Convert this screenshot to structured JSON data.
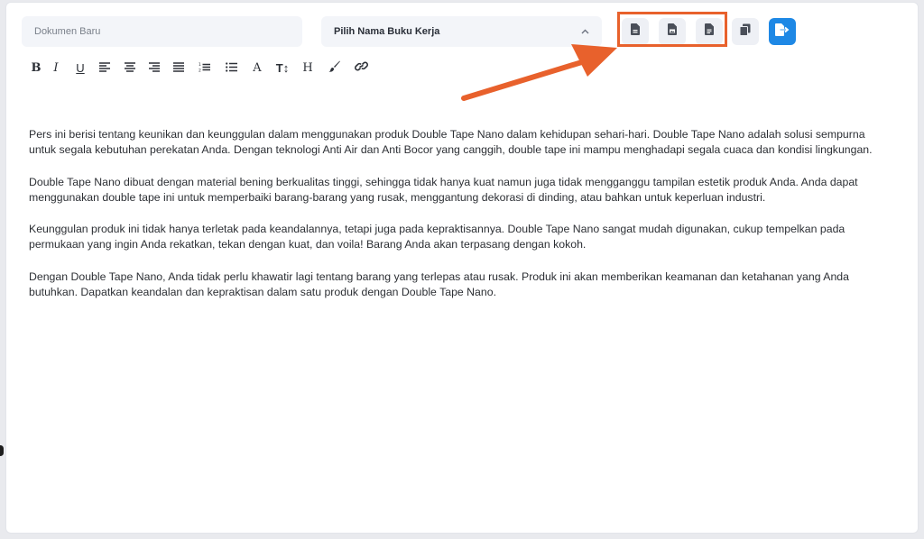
{
  "document": {
    "title_placeholder": "Dokumen Baru"
  },
  "workbook_select": {
    "label": "Pilih Nama Buku Kerja",
    "icon": "chevron-up-icon"
  },
  "export_buttons": [
    {
      "name": "export-doc-button-1",
      "icon": "file-icon"
    },
    {
      "name": "export-doc-button-2",
      "icon": "file-image-icon"
    },
    {
      "name": "export-doc-button-3",
      "icon": "file-text-icon"
    }
  ],
  "copy_button": {
    "icon": "copy-icon"
  },
  "save_button": {
    "icon": "file-export-icon",
    "color": "#1e88e5"
  },
  "annotation": {
    "color": "#e8612c"
  },
  "toolbar": {
    "bold": "B",
    "italic": "I",
    "underline": "U",
    "font_size": "A",
    "text_height": "T↕",
    "heading": "H"
  },
  "content": {
    "paragraphs": [
      "Pers ini berisi tentang keunikan dan keunggulan dalam menggunakan produk Double Tape Nano dalam kehidupan sehari-hari. Double Tape Nano adalah solusi sempurna untuk segala kebutuhan perekatan Anda. Dengan teknologi Anti Air dan Anti Bocor yang canggih, double tape ini mampu menghadapi segala cuaca dan kondisi lingkungan.",
      "Double Tape Nano dibuat dengan material bening berkualitas tinggi, sehingga tidak hanya kuat namun juga tidak mengganggu tampilan estetik produk Anda. Anda dapat menggunakan double tape ini untuk memperbaiki barang-barang yang rusak, menggantung dekorasi di dinding, atau bahkan untuk keperluan industri.",
      "Keunggulan produk ini tidak hanya terletak pada keandalannya, tetapi juga pada kepraktisannya. Double Tape Nano sangat mudah digunakan, cukup tempelkan pada permukaan yang ingin Anda rekatkan, tekan dengan kuat, dan voila! Barang Anda akan terpasang dengan kokoh.",
      "Dengan Double Tape Nano, Anda tidak perlu khawatir lagi tentang barang yang terlepas atau rusak. Produk ini akan memberikan keamanan dan ketahanan yang Anda butuhkan. Dapatkan keandalan dan kepraktisan dalam satu produk dengan Double Tape Nano."
    ]
  }
}
